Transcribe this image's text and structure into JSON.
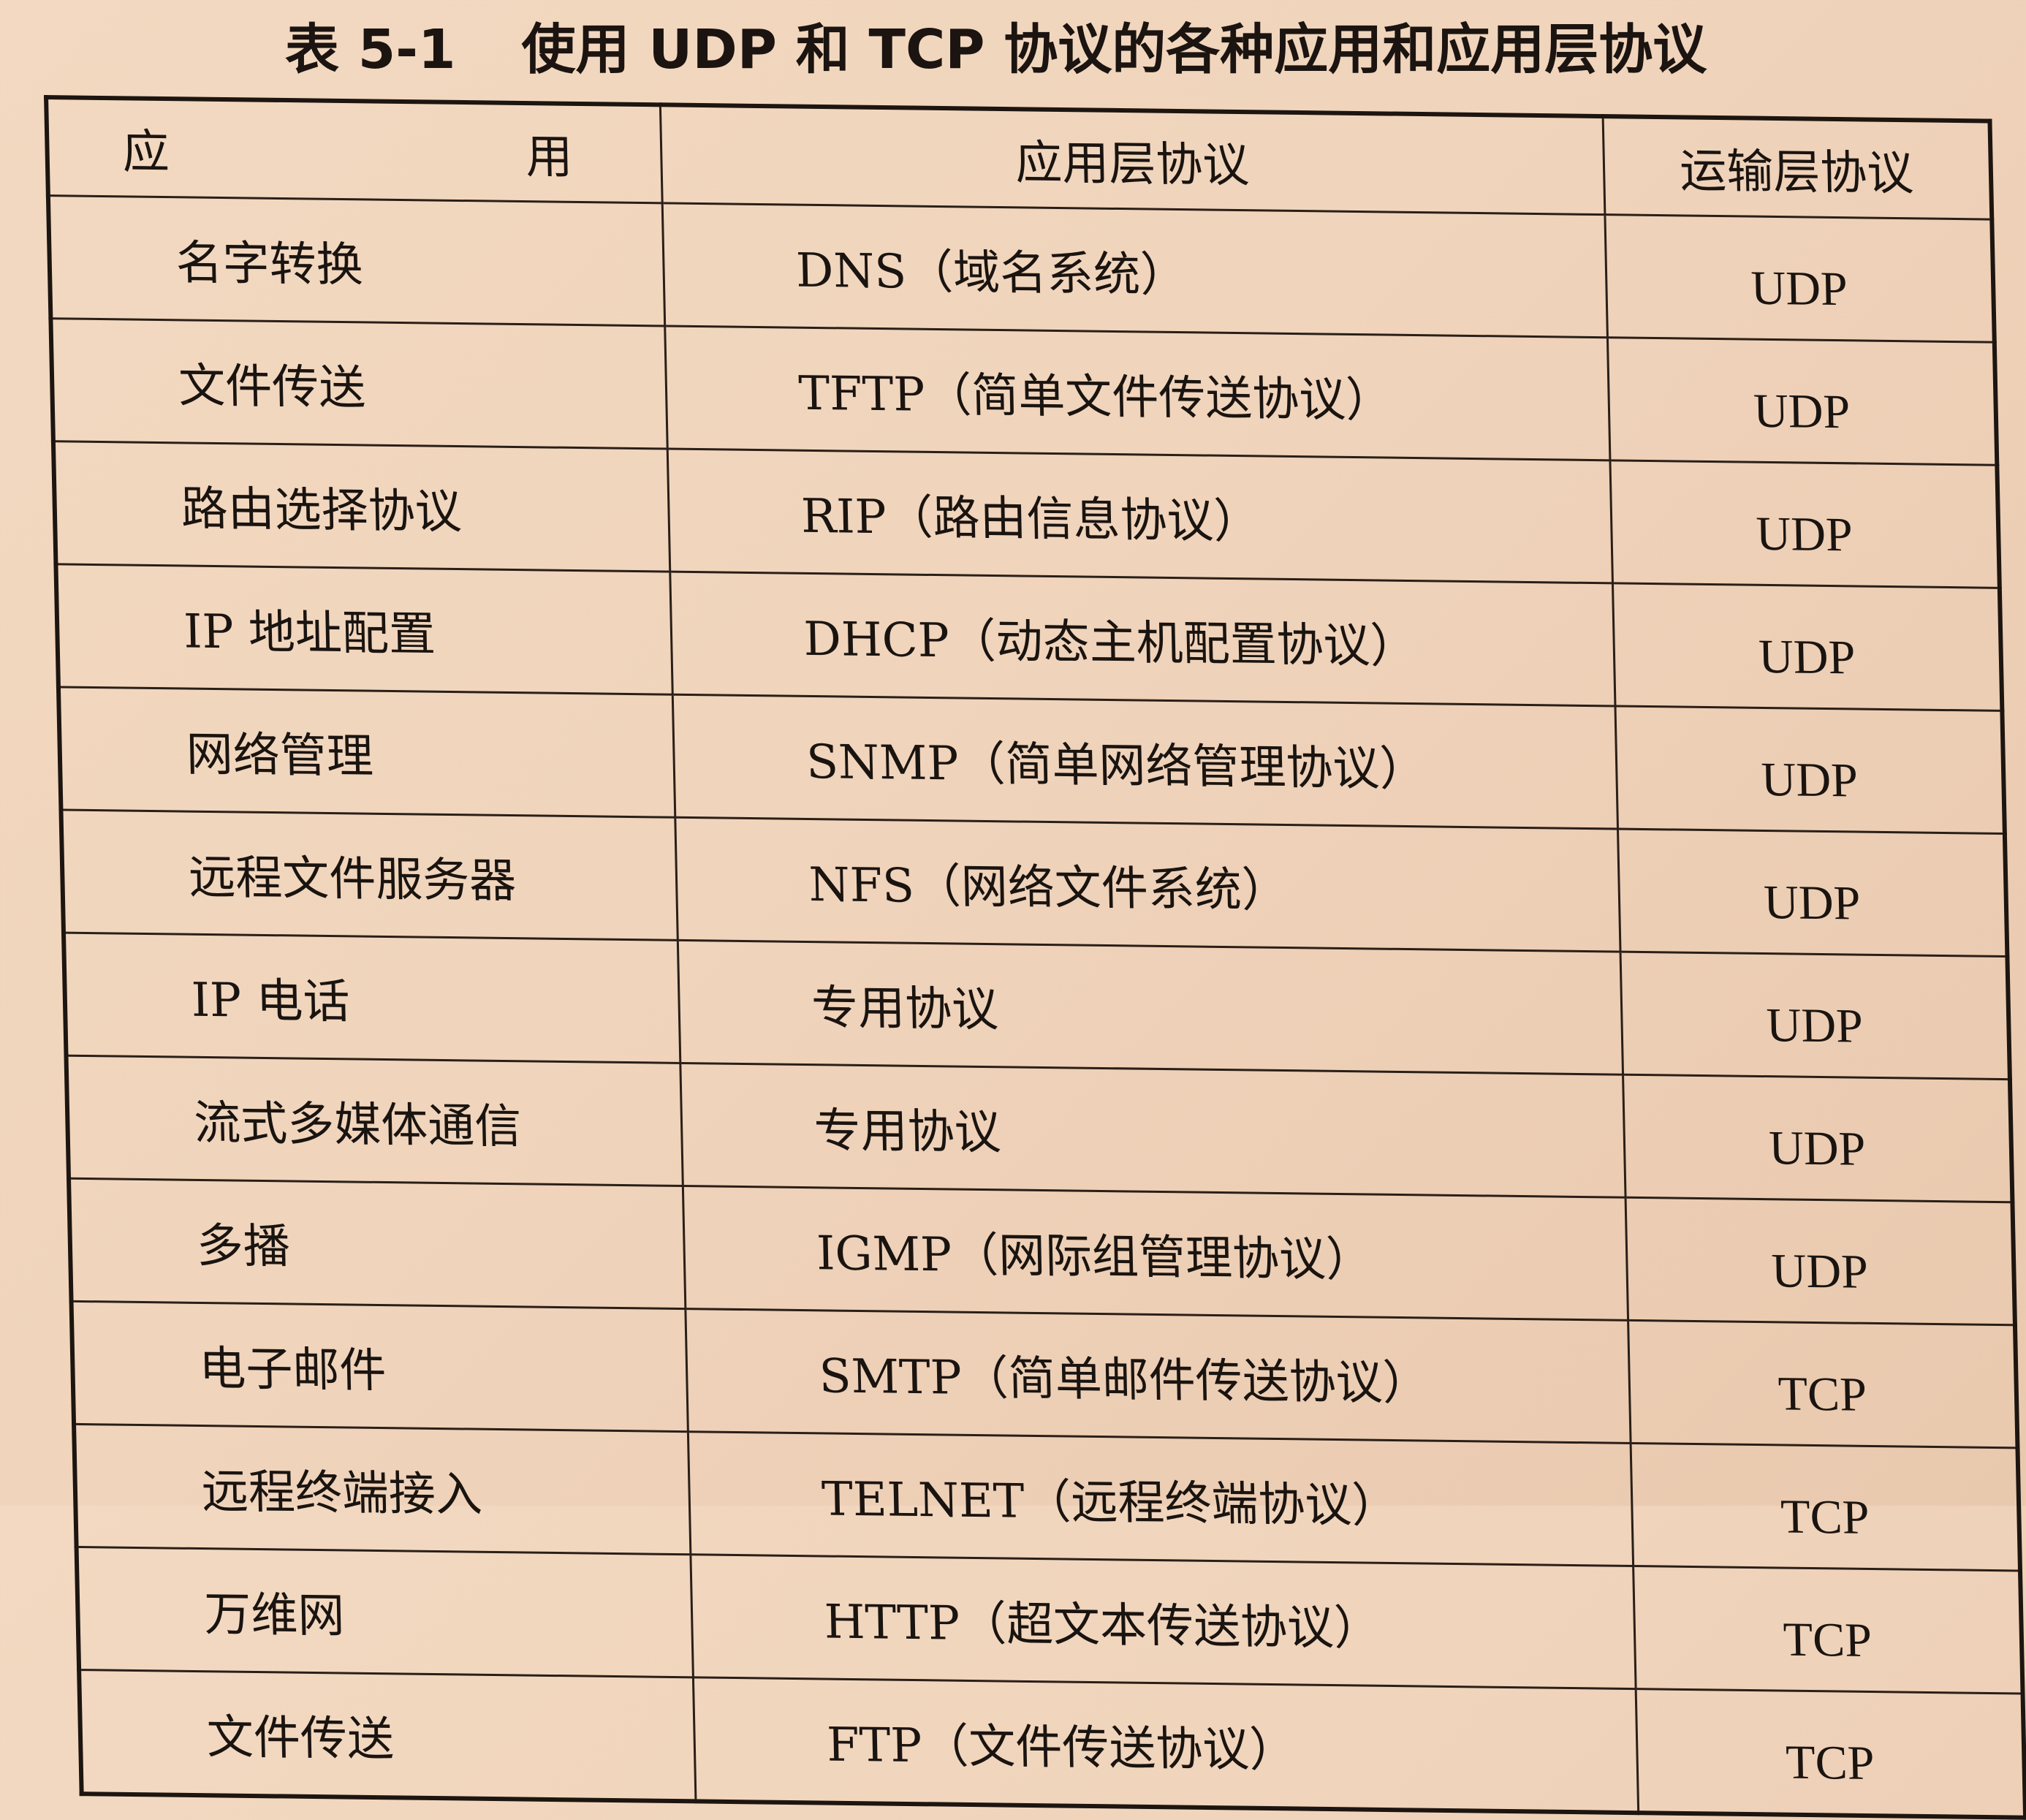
{
  "title": {
    "label": "表 5-1",
    "text": "使用 UDP 和 TCP 协议的各种应用和应用层协议"
  },
  "table": {
    "headers": {
      "application": "应　　用",
      "app_protocol": "应用层协议",
      "transport_protocol": "运输层协议"
    },
    "rows": [
      {
        "application": "名字转换",
        "app_protocol": "DNS（域名系统）",
        "transport_protocol": "UDP"
      },
      {
        "application": "文件传送",
        "app_protocol": "TFTP（简单文件传送协议）",
        "transport_protocol": "UDP"
      },
      {
        "application": "路由选择协议",
        "app_protocol": "RIP（路由信息协议）",
        "transport_protocol": "UDP"
      },
      {
        "application": "IP 地址配置",
        "app_protocol": "DHCP（动态主机配置协议）",
        "transport_protocol": "UDP"
      },
      {
        "application": "网络管理",
        "app_protocol": "SNMP（简单网络管理协议）",
        "transport_protocol": "UDP"
      },
      {
        "application": "远程文件服务器",
        "app_protocol": "NFS（网络文件系统）",
        "transport_protocol": "UDP"
      },
      {
        "application": "IP 电话",
        "app_protocol": "专用协议",
        "transport_protocol": "UDP"
      },
      {
        "application": "流式多媒体通信",
        "app_protocol": "专用协议",
        "transport_protocol": "UDP"
      },
      {
        "application": "多播",
        "app_protocol": "IGMP（网际组管理协议）",
        "transport_protocol": "UDP"
      },
      {
        "application": "电子邮件",
        "app_protocol": "SMTP（简单邮件传送协议）",
        "transport_protocol": "TCP"
      },
      {
        "application": "远程终端接入",
        "app_protocol": "TELNET（远程终端协议）",
        "transport_protocol": "TCP"
      },
      {
        "application": "万维网",
        "app_protocol": "HTTP（超文本传送协议）",
        "transport_protocol": "TCP"
      },
      {
        "application": "文件传送",
        "app_protocol": "FTP（文件传送协议）",
        "transport_protocol": "TCP"
      }
    ]
  }
}
